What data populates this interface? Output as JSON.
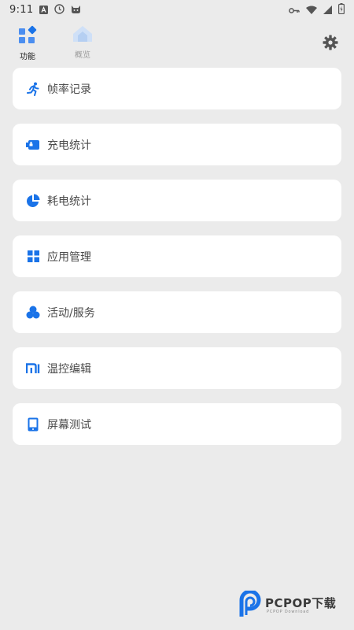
{
  "status_bar": {
    "time": "9:11",
    "icons": [
      "a-letter-icon",
      "clock-icon",
      "cat-icon",
      "vpn-key-icon",
      "wifi-icon",
      "signal-icon",
      "battery-charging-icon"
    ]
  },
  "nav": {
    "tabs": [
      {
        "label": "功能",
        "icon": "grid-apps-icon",
        "active": true
      },
      {
        "label": "概览",
        "icon": "house-icon",
        "active": false
      }
    ],
    "settings_icon": "gear-icon"
  },
  "menu": {
    "items": [
      {
        "label": "帧率记录",
        "icon": "running-person-icon"
      },
      {
        "label": "充电统计",
        "icon": "battery-charge-icon"
      },
      {
        "label": "耗电统计",
        "icon": "pie-chart-icon"
      },
      {
        "label": "应用管理",
        "icon": "grid-icon"
      },
      {
        "label": "活动/服务",
        "icon": "circles-icon"
      },
      {
        "label": "温控编辑",
        "icon": "mi-logo-icon"
      },
      {
        "label": "屏幕测试",
        "icon": "tablet-icon"
      }
    ]
  },
  "watermark": {
    "brand": "PCPOP下载",
    "sub": "PCPOP Download"
  },
  "colors": {
    "accent": "#1a73e8",
    "background": "#ebebeb",
    "card": "#ffffff",
    "text": "#4a4a4a"
  }
}
